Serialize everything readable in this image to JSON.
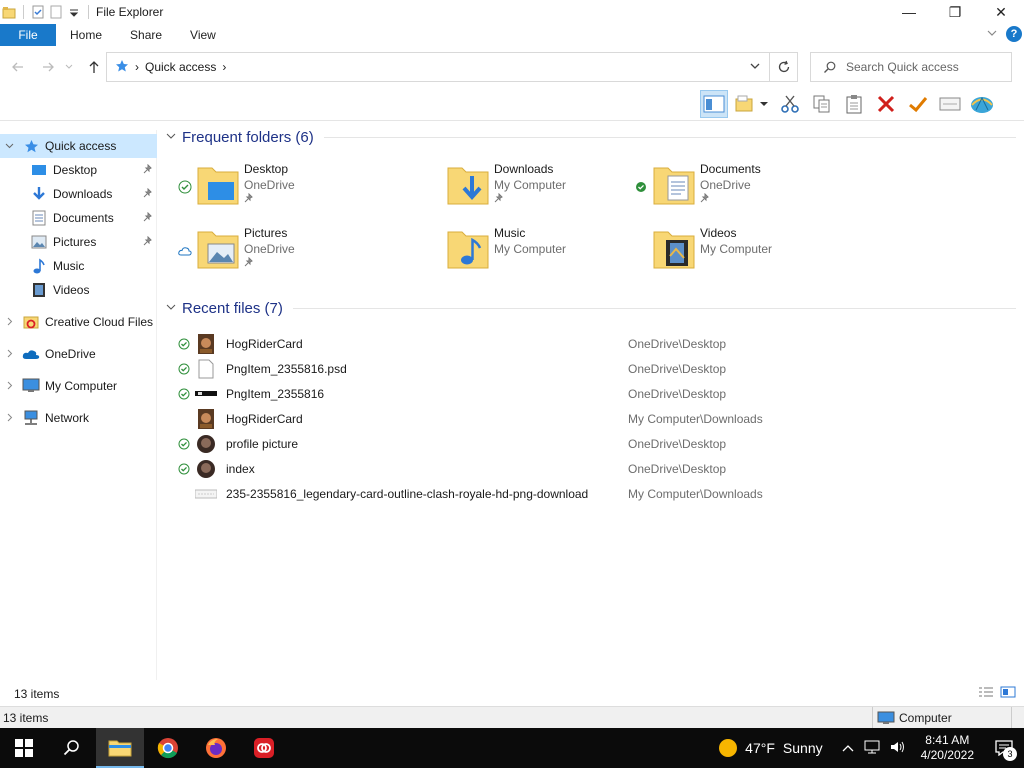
{
  "titlebar": {
    "title": "File Explorer",
    "minimize": "—",
    "maximize": "❐",
    "close": "✕"
  },
  "ribbon": {
    "tabs": [
      "File",
      "Home",
      "Share",
      "View"
    ],
    "help": "?"
  },
  "address": {
    "crumb": "Quick access",
    "search_placeholder": "Search Quick access"
  },
  "sidebar": {
    "items": [
      {
        "label": "Quick access",
        "icon": "star-icon",
        "pinned": false
      },
      {
        "label": "Desktop",
        "icon": "desktop-folder-icon",
        "pinned": true
      },
      {
        "label": "Downloads",
        "icon": "download-arrow-icon",
        "pinned": true
      },
      {
        "label": "Documents",
        "icon": "document-icon",
        "pinned": true
      },
      {
        "label": "Pictures",
        "icon": "picture-icon",
        "pinned": true
      },
      {
        "label": "Music",
        "icon": "music-note-icon",
        "pinned": false
      },
      {
        "label": "Videos",
        "icon": "film-icon",
        "pinned": false
      },
      {
        "label": "Creative Cloud Files",
        "icon": "creative-cloud-icon",
        "pinned": false
      },
      {
        "label": "OneDrive",
        "icon": "cloud-icon",
        "pinned": false
      },
      {
        "label": "My Computer",
        "icon": "computer-icon",
        "pinned": false
      },
      {
        "label": "Network",
        "icon": "network-icon",
        "pinned": false
      }
    ],
    "pin_glyph": "📌"
  },
  "frequent": {
    "header": "Frequent folders (6)",
    "folders": [
      {
        "name": "Desktop",
        "location": "OneDrive",
        "status": "synced",
        "overlay": "desktop"
      },
      {
        "name": "Downloads",
        "location": "My Computer",
        "status": "",
        "overlay": "download"
      },
      {
        "name": "Documents",
        "location": "OneDrive",
        "status": "synced",
        "overlay": "document"
      },
      {
        "name": "Pictures",
        "location": "OneDrive",
        "status": "cloud",
        "overlay": "picture"
      },
      {
        "name": "Music",
        "location": "My Computer",
        "status": "",
        "overlay": "music"
      },
      {
        "name": "Videos",
        "location": "My Computer",
        "status": "",
        "overlay": "video"
      }
    ]
  },
  "recent": {
    "header": "Recent files (7)",
    "files": [
      {
        "name": "HogRiderCard",
        "location": "OneDrive\\Desktop",
        "status": "synced",
        "thumb": "card"
      },
      {
        "name": "PngItem_2355816.psd",
        "location": "OneDrive\\Desktop",
        "status": "synced",
        "thumb": "blank"
      },
      {
        "name": "PngItem_2355816",
        "location": "OneDrive\\Desktop",
        "status": "synced",
        "thumb": "strip"
      },
      {
        "name": "HogRiderCard",
        "location": "My Computer\\Downloads",
        "status": "",
        "thumb": "card"
      },
      {
        "name": "profile picture",
        "location": "OneDrive\\Desktop",
        "status": "synced",
        "thumb": "face"
      },
      {
        "name": "index",
        "location": "OneDrive\\Desktop",
        "status": "synced",
        "thumb": "face"
      },
      {
        "name": "235-2355816_legendary-card-outline-clash-royale-hd-png-download",
        "location": "My Computer\\Downloads",
        "status": "",
        "thumb": "outline"
      }
    ]
  },
  "statusbar": {
    "items": "13 items",
    "outer_items": "13 items",
    "zone": "Computer"
  },
  "taskbar": {
    "weather_temp": "47°F",
    "weather_text": "Sunny",
    "time": "8:41 AM",
    "date": "4/20/2022",
    "notifications": "3"
  },
  "colors": {
    "accent": "#1979ca",
    "header_blue": "#1e3287",
    "selected_bg": "#cce8ff",
    "folder_yellow": "#f8d775",
    "sync_green": "#2f8f3b"
  }
}
